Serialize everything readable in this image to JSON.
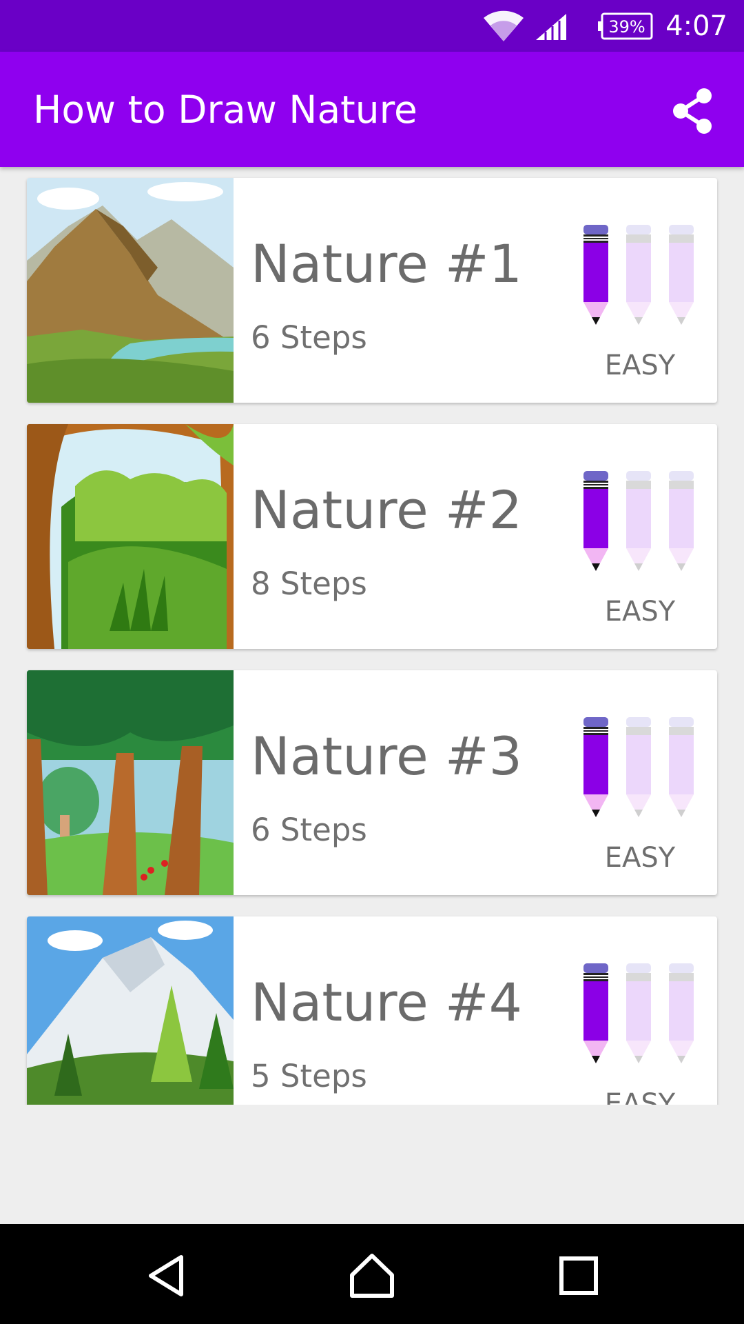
{
  "status_bar": {
    "battery": "39%",
    "time": "4:07",
    "icons": [
      "wifi-icon",
      "cell-signal-icon",
      "battery-icon"
    ]
  },
  "app_bar": {
    "title": "How to Draw Nature",
    "share_icon": "share-icon"
  },
  "colors": {
    "status_bar": "#6a00c6",
    "app_bar": "#8f00ef",
    "pencil_active": "#8b00e6",
    "pencil_inactive": "#ecd7fb"
  },
  "items": [
    {
      "title": "Nature #1",
      "steps": "6 Steps",
      "difficulty": "EASY",
      "rating": 1,
      "rating_max": 3,
      "thumbnail": "mountain-river-landscape"
    },
    {
      "title": "Nature #2",
      "steps": "8 Steps",
      "difficulty": "EASY",
      "rating": 1,
      "rating_max": 3,
      "thumbnail": "jungle-cave-landscape"
    },
    {
      "title": "Nature #3",
      "steps": "6 Steps",
      "difficulty": "EASY",
      "rating": 1,
      "rating_max": 3,
      "thumbnail": "forest-trees-landscape"
    },
    {
      "title": "Nature #4",
      "steps": "5 Steps",
      "difficulty": "EASY",
      "rating": 1,
      "rating_max": 3,
      "thumbnail": "snowy-mountain-pines-landscape"
    }
  ],
  "nav_bar": {
    "icons": [
      "back-icon",
      "home-icon",
      "recents-icon"
    ]
  }
}
